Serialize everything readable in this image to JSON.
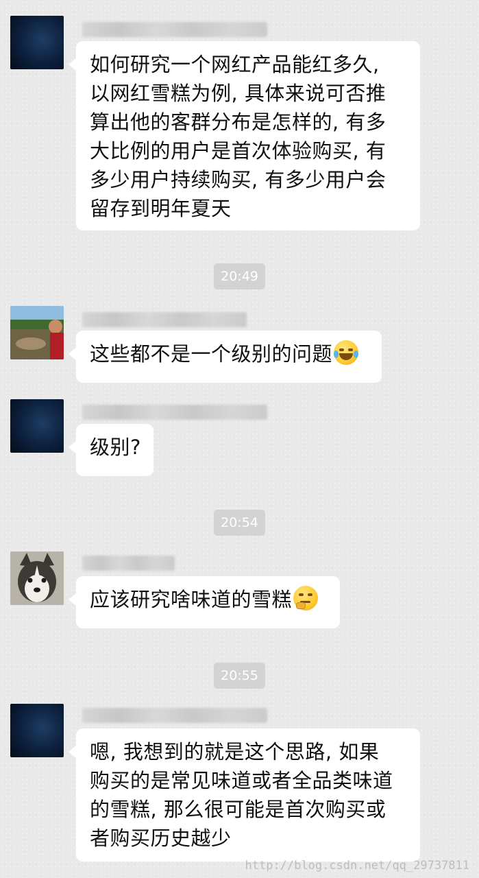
{
  "messages": [
    {
      "avatar": "dark-blue-avatar",
      "lines": [
        "如何研究一个网红产品能红多久,",
        "以网红雪糕为例, 具体来说可否推",
        "算出他的客群分布是怎样的, 有多",
        "大比例的用户是首次体验购买, 有",
        "多少用户持续购买, 有多少用户会",
        "留存到明年夏天"
      ]
    },
    {
      "timestamp": "20:49"
    },
    {
      "avatar": "man-photo-avatar",
      "text": "这些都不是一个级别的问题",
      "emoji": "laughing-tears-emoji"
    },
    {
      "avatar": "dark-blue-avatar",
      "text": "级别?"
    },
    {
      "timestamp": "20:54"
    },
    {
      "avatar": "husky-dog-avatar",
      "text": "应该研究啥味道的雪糕",
      "emoji": "thinking-emoji"
    },
    {
      "timestamp": "20:55"
    },
    {
      "avatar": "dark-blue-avatar",
      "lines": [
        "嗯, 我想到的就是这个思路, 如果",
        "购买的是常见味道或者全品类味道",
        "的雪糕, 那么很可能是首次购买或",
        "者购买历史越少"
      ]
    }
  ],
  "watermark": "http://blog.csdn.net/qq_29737811"
}
